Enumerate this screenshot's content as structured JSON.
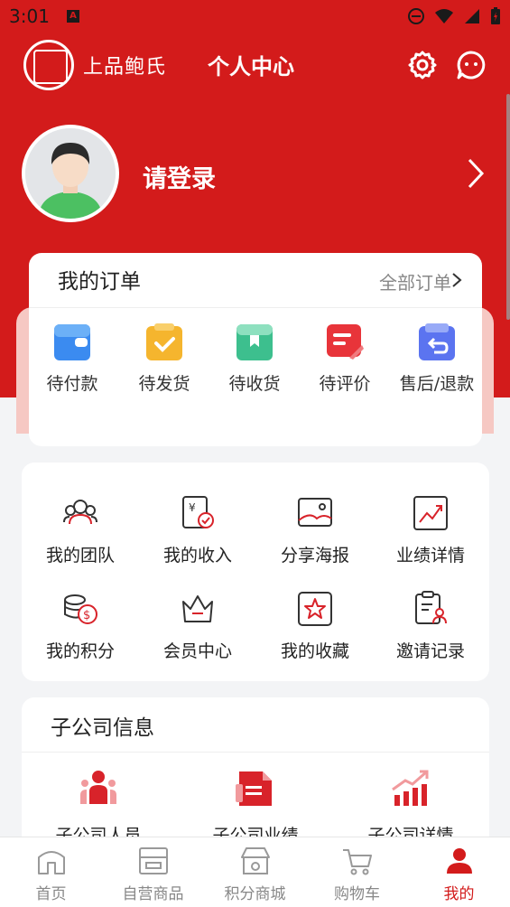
{
  "status_bar": {
    "time": "3:01",
    "notification_badge": "A"
  },
  "header": {
    "logo_text": "上品鲍氏",
    "title": "个人中心"
  },
  "profile": {
    "login_label": "请登录"
  },
  "orders": {
    "title": "我的订单",
    "all_label": "全部订单",
    "items": [
      {
        "label": "待付款",
        "icon": "wallet-icon",
        "color": "#3b8bf0"
      },
      {
        "label": "待发货",
        "icon": "clipboard-check-icon",
        "color": "#f5b52e"
      },
      {
        "label": "待收货",
        "icon": "package-icon",
        "color": "#3dbf8e"
      },
      {
        "label": "待评价",
        "icon": "review-icon",
        "color": "#e8343a"
      },
      {
        "label": "售后/退款",
        "icon": "refund-icon",
        "color": "#5b74f0"
      }
    ]
  },
  "tools": {
    "items": [
      {
        "label": "我的团队",
        "icon": "team-icon"
      },
      {
        "label": "我的收入",
        "icon": "income-icon"
      },
      {
        "label": "分享海报",
        "icon": "poster-icon"
      },
      {
        "label": "业绩详情",
        "icon": "performance-icon"
      },
      {
        "label": "我的积分",
        "icon": "points-icon"
      },
      {
        "label": "会员中心",
        "icon": "crown-icon"
      },
      {
        "label": "我的收藏",
        "icon": "favorite-star-icon"
      },
      {
        "label": "邀请记录",
        "icon": "invite-record-icon"
      }
    ]
  },
  "subsidiary": {
    "title": "子公司信息",
    "items": [
      {
        "label": "子公司人员",
        "icon": "staff-icon"
      },
      {
        "label": "子公司业绩",
        "icon": "report-icon"
      },
      {
        "label": "子公司详情",
        "icon": "bar-chart-icon"
      }
    ]
  },
  "tabbar": {
    "items": [
      {
        "label": "首页",
        "icon": "home-icon",
        "active": false
      },
      {
        "label": "自营商品",
        "icon": "store-icon",
        "active": false
      },
      {
        "label": "积分商城",
        "icon": "points-mall-icon",
        "active": false
      },
      {
        "label": "购物车",
        "icon": "cart-icon",
        "active": false
      },
      {
        "label": "我的",
        "icon": "user-icon",
        "active": true
      }
    ]
  },
  "colors": {
    "brand_red": "#d31b1b",
    "tab_inactive": "#888888",
    "accent_red": "#d8232a"
  }
}
